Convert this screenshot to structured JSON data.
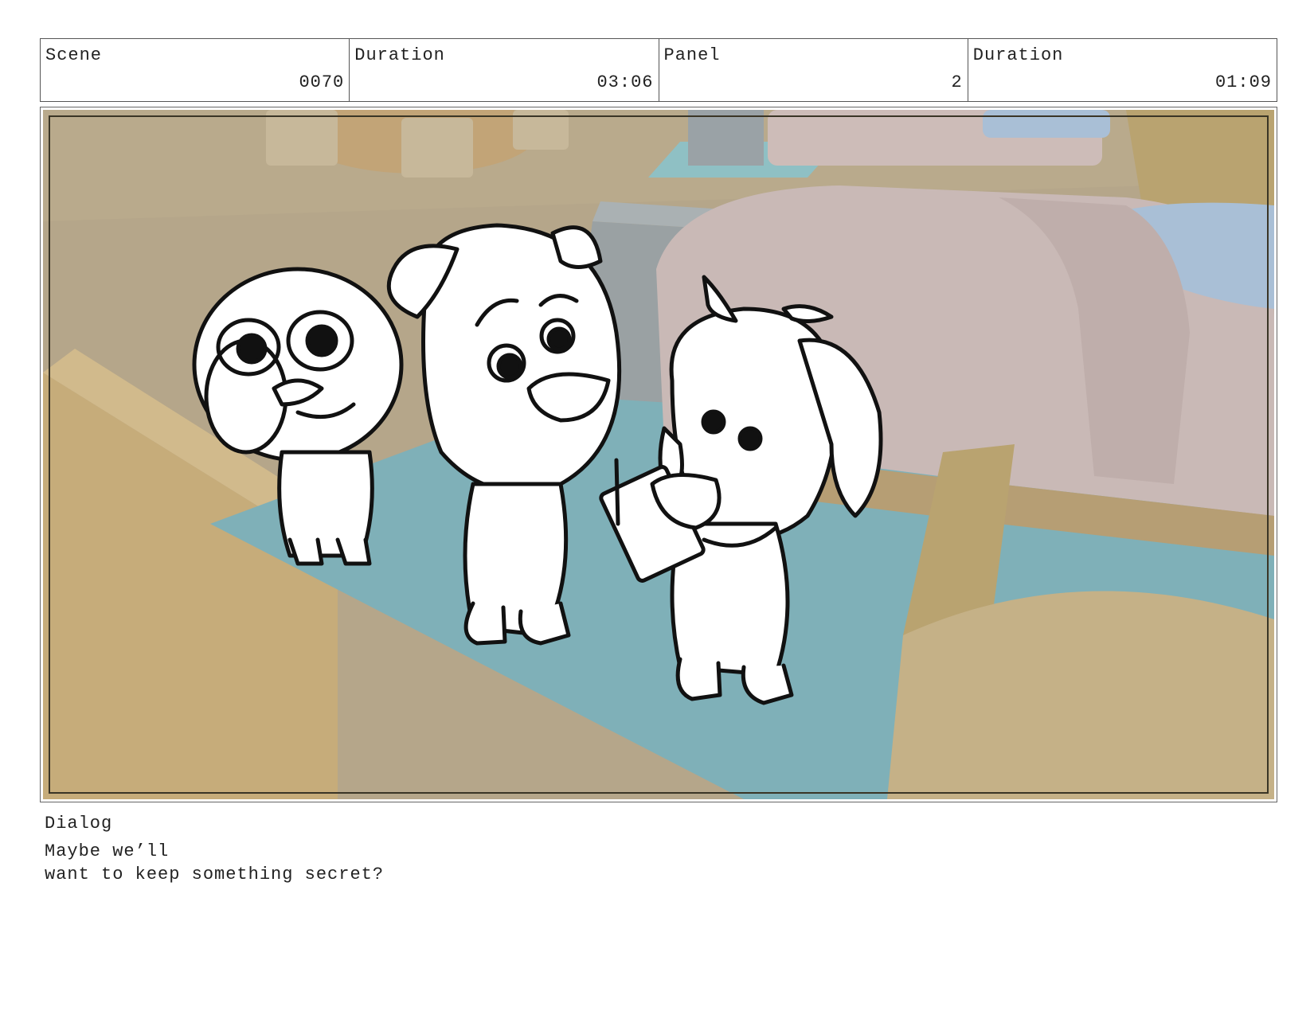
{
  "header": {
    "scene_label": "Scene",
    "scene_value": "0070",
    "duration_label": "Duration",
    "duration_value": "03:06",
    "panel_label": "Panel",
    "panel_value": "2",
    "panel_duration_label": "Duration",
    "panel_duration_value": "01:09"
  },
  "dialog": {
    "label": "Dialog",
    "lines": [
      "Maybe we’ll",
      "want to keep something secret?"
    ]
  },
  "colors": {
    "floor": "#b5a68a",
    "rug": "#7fb0b8",
    "bed": "#c9b9b6",
    "pillow": "#a9bfd6",
    "wood": "#c2ae83",
    "nightstand": "#9aa1a3",
    "ink": "#111111"
  }
}
